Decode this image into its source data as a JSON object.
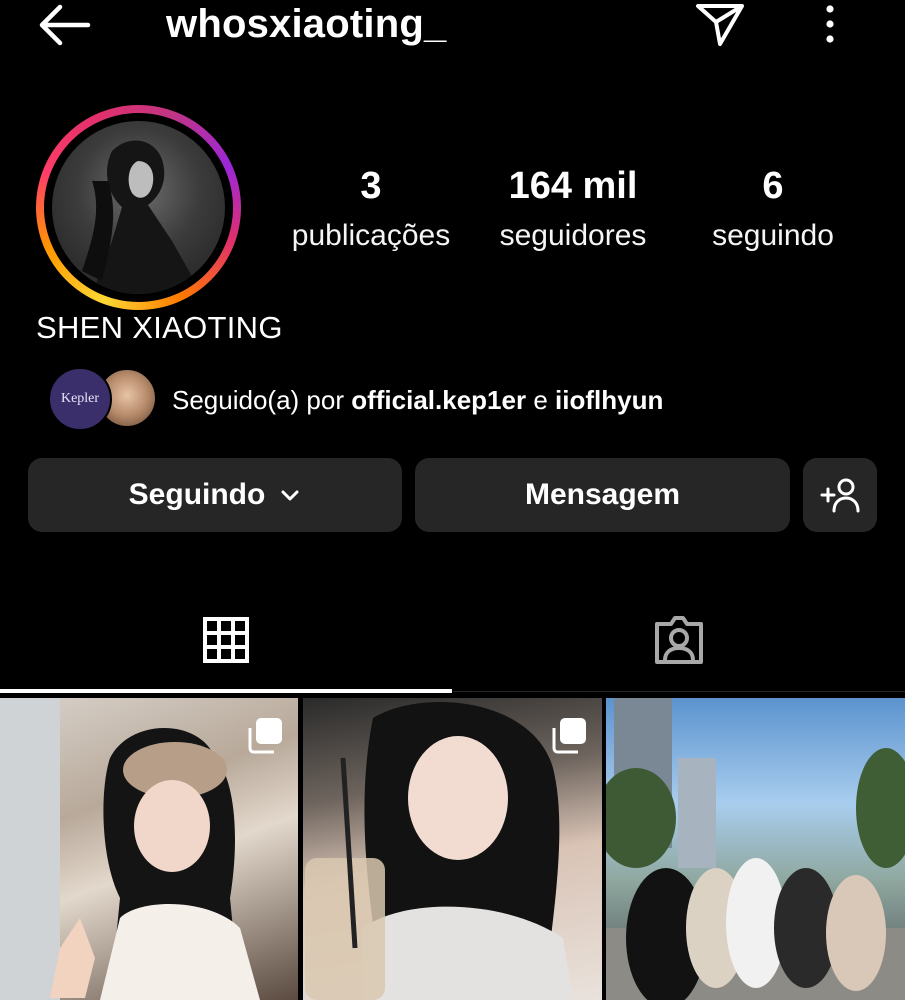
{
  "header": {
    "username": "whosxiaoting_",
    "back_icon": "arrow-left-icon",
    "send_icon": "paper-plane-icon",
    "more_icon": "more-vertical-icon"
  },
  "profile": {
    "display_name": "SHEN XIAOTING",
    "ring_colors": [
      "#fdd835",
      "#ff9800",
      "#e1306c",
      "#c13584"
    ]
  },
  "stats": {
    "posts": {
      "value": "3",
      "label": "publicações"
    },
    "followers": {
      "value": "164 mil",
      "label": "seguidores"
    },
    "following": {
      "value": "6",
      "label": "seguindo"
    }
  },
  "followed_by": {
    "avatar1_text": "Kepler",
    "prefix": "Seguido(a) por ",
    "user1": "official.kep1er",
    "joiner": " e ",
    "user2": "iioflhyun"
  },
  "actions": {
    "following_label": "Seguindo",
    "message_label": "Mensagem",
    "suggest_icon": "add-person-icon"
  },
  "tabs": {
    "grid_icon": "grid-icon",
    "tagged_icon": "tagged-portrait-icon",
    "active": "grid"
  },
  "posts": [
    {
      "multiple": true
    },
    {
      "multiple": true
    },
    {
      "multiple": false
    }
  ]
}
